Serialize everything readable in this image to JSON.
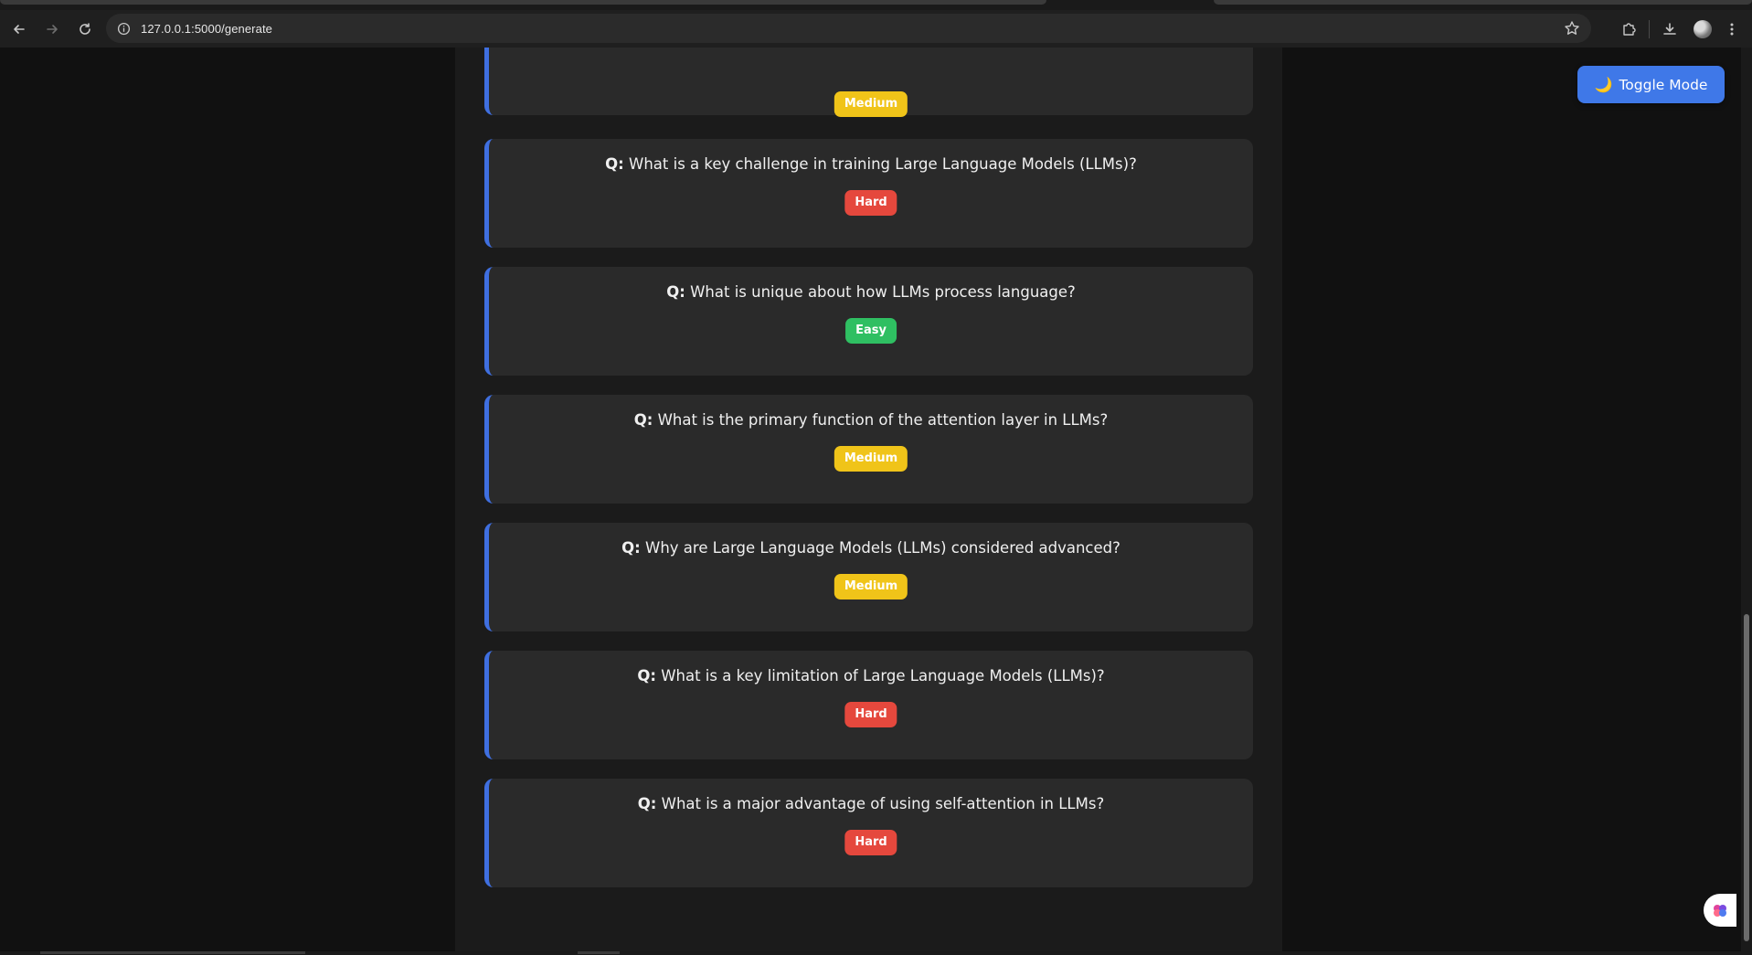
{
  "browser": {
    "url": "127.0.0.1:5000/generate",
    "back_icon": "arrow-left-icon",
    "forward_icon": "arrow-right-icon",
    "reload_icon": "reload-icon",
    "site_info_icon": "info-icon",
    "bookmark_icon": "star-icon",
    "extensions_icon": "puzzle-icon",
    "download_icon": "download-icon",
    "menu_icon": "kebab-menu-icon"
  },
  "toggle_button": {
    "icon": "moon-icon",
    "icon_glyph": "🌙",
    "label": "Toggle Mode"
  },
  "questions": [
    {
      "prefix": "Q:",
      "text": "What is a key challenge in training Large Language Models (LLMs)?",
      "difficulty": "Hard",
      "level": "hard"
    },
    {
      "prefix": "Q:",
      "text": "What is unique about how LLMs process language?",
      "difficulty": "Easy",
      "level": "easy"
    },
    {
      "prefix": "Q:",
      "text": "What is the primary function of the attention layer in LLMs?",
      "difficulty": "Medium",
      "level": "medium"
    },
    {
      "prefix": "Q:",
      "text": "Why are Large Language Models (LLMs) considered advanced?",
      "difficulty": "Medium",
      "level": "medium"
    },
    {
      "prefix": "Q:",
      "text": "What is a key limitation of Large Language Models (LLMs)?",
      "difficulty": "Hard",
      "level": "hard"
    },
    {
      "prefix": "Q:",
      "text": "What is a major advantage of using self-attention in LLMs?",
      "difficulty": "Hard",
      "level": "hard"
    }
  ],
  "partial_card": {
    "difficulty": "Medium",
    "level": "medium"
  },
  "colors": {
    "accent": "#3f6fe0",
    "medium": "#f0c419",
    "hard": "#e5483d",
    "easy": "#2fbf62"
  }
}
